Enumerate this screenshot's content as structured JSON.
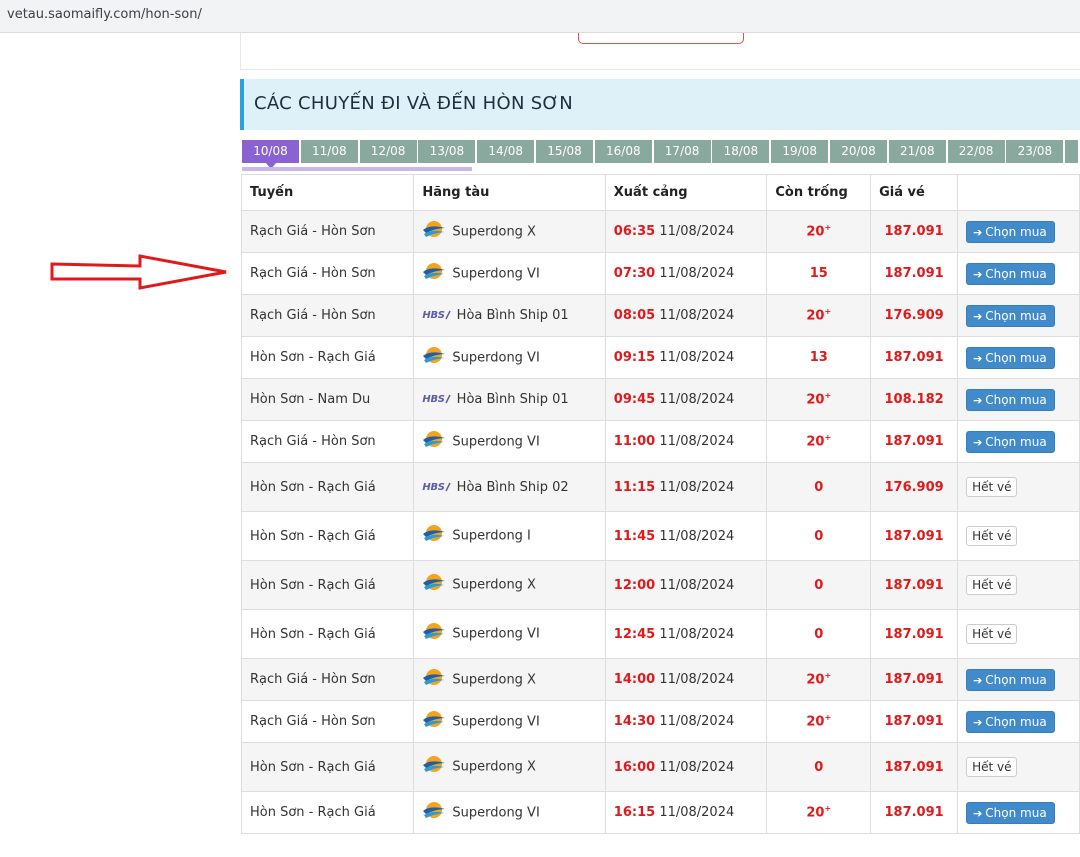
{
  "browser": {
    "url": "vetau.saomaifly.com/hon-son/"
  },
  "section": {
    "title": "CÁC CHUYẾN ĐI VÀ ĐẾN HÒN SƠN"
  },
  "dates": [
    "10/08",
    "11/08",
    "12/08",
    "13/08",
    "14/08",
    "15/08",
    "16/08",
    "17/08",
    "18/08",
    "19/08",
    "20/08",
    "21/08",
    "22/08",
    "23/08"
  ],
  "table": {
    "headers": [
      "Tuyến",
      "Hãng tàu",
      "Xuất cảng",
      "Còn trống",
      "Giá vé"
    ],
    "buy_label": "Chọn mua",
    "sold_label": "Hết vé",
    "rows": [
      {
        "route": "Rạch Giá - Hòn Sơn",
        "ship": "Superdong X",
        "logo": "superdong",
        "time": "06:35",
        "date": "11/08/2024",
        "seats": "20",
        "plus": true,
        "price": "187.091",
        "available": true
      },
      {
        "route": "Rạch Giá - Hòn Sơn",
        "ship": "Superdong VI",
        "logo": "superdong",
        "time": "07:30",
        "date": "11/08/2024",
        "seats": "15",
        "plus": false,
        "price": "187.091",
        "available": true
      },
      {
        "route": "Rạch Giá - Hòn Sơn",
        "ship": "Hòa Bình Ship 01",
        "logo": "hbs",
        "time": "08:05",
        "date": "11/08/2024",
        "seats": "20",
        "plus": true,
        "price": "176.909",
        "available": true
      },
      {
        "route": "Hòn Sơn - Rạch Giá",
        "ship": "Superdong VI",
        "logo": "superdong",
        "time": "09:15",
        "date": "11/08/2024",
        "seats": "13",
        "plus": false,
        "price": "187.091",
        "available": true
      },
      {
        "route": "Hòn Sơn - Nam Du",
        "ship": "Hòa Bình Ship 01",
        "logo": "hbs",
        "time": "09:45",
        "date": "11/08/2024",
        "seats": "20",
        "plus": true,
        "price": "108.182",
        "available": true
      },
      {
        "route": "Rạch Giá - Hòn Sơn",
        "ship": "Superdong VI",
        "logo": "superdong",
        "time": "11:00",
        "date": "11/08/2024",
        "seats": "20",
        "plus": true,
        "price": "187.091",
        "available": true
      },
      {
        "route": "Hòn Sơn - Rạch Giá",
        "ship": "Hòa Bình Ship 02",
        "logo": "hbs",
        "time": "11:15",
        "date": "11/08/2024",
        "seats": "0",
        "plus": false,
        "price": "176.909",
        "available": false
      },
      {
        "route": "Hòn Sơn - Rạch Giá",
        "ship": "Superdong I",
        "logo": "superdong",
        "time": "11:45",
        "date": "11/08/2024",
        "seats": "0",
        "plus": false,
        "price": "187.091",
        "available": false
      },
      {
        "route": "Hòn Sơn - Rạch Giá",
        "ship": "Superdong X",
        "logo": "superdong",
        "time": "12:00",
        "date": "11/08/2024",
        "seats": "0",
        "plus": false,
        "price": "187.091",
        "available": false
      },
      {
        "route": "Hòn Sơn - Rạch Giá",
        "ship": "Superdong VI",
        "logo": "superdong",
        "time": "12:45",
        "date": "11/08/2024",
        "seats": "0",
        "plus": false,
        "price": "187.091",
        "available": false
      },
      {
        "route": "Rạch Giá - Hòn Sơn",
        "ship": "Superdong X",
        "logo": "superdong",
        "time": "14:00",
        "date": "11/08/2024",
        "seats": "20",
        "plus": true,
        "price": "187.091",
        "available": true
      },
      {
        "route": "Rạch Giá - Hòn Sơn",
        "ship": "Superdong VI",
        "logo": "superdong",
        "time": "14:30",
        "date": "11/08/2024",
        "seats": "20",
        "plus": true,
        "price": "187.091",
        "available": true
      },
      {
        "route": "Hòn Sơn - Rạch Giá",
        "ship": "Superdong X",
        "logo": "superdong",
        "time": "16:00",
        "date": "11/08/2024",
        "seats": "0",
        "plus": false,
        "price": "187.091",
        "available": false
      },
      {
        "route": "Hòn Sơn - Rạch Giá",
        "ship": "Superdong VI",
        "logo": "superdong",
        "time": "16:15",
        "date": "11/08/2024",
        "seats": "20",
        "plus": true,
        "price": "187.091",
        "available": true
      }
    ]
  },
  "annotation": {
    "arrow_icon": "red-outline-arrow-right"
  },
  "colors": {
    "accent": "#2aa1d8",
    "date_active": "#8a63d2",
    "date_tab": "#8aa99e",
    "price_red": "#e0191b",
    "buy_blue": "#428bca"
  },
  "icons": {
    "superdong_logo": "superdong-logo-icon",
    "hbs_logo": "hbs-logo-icon",
    "arrow": "arrow-right-icon"
  }
}
